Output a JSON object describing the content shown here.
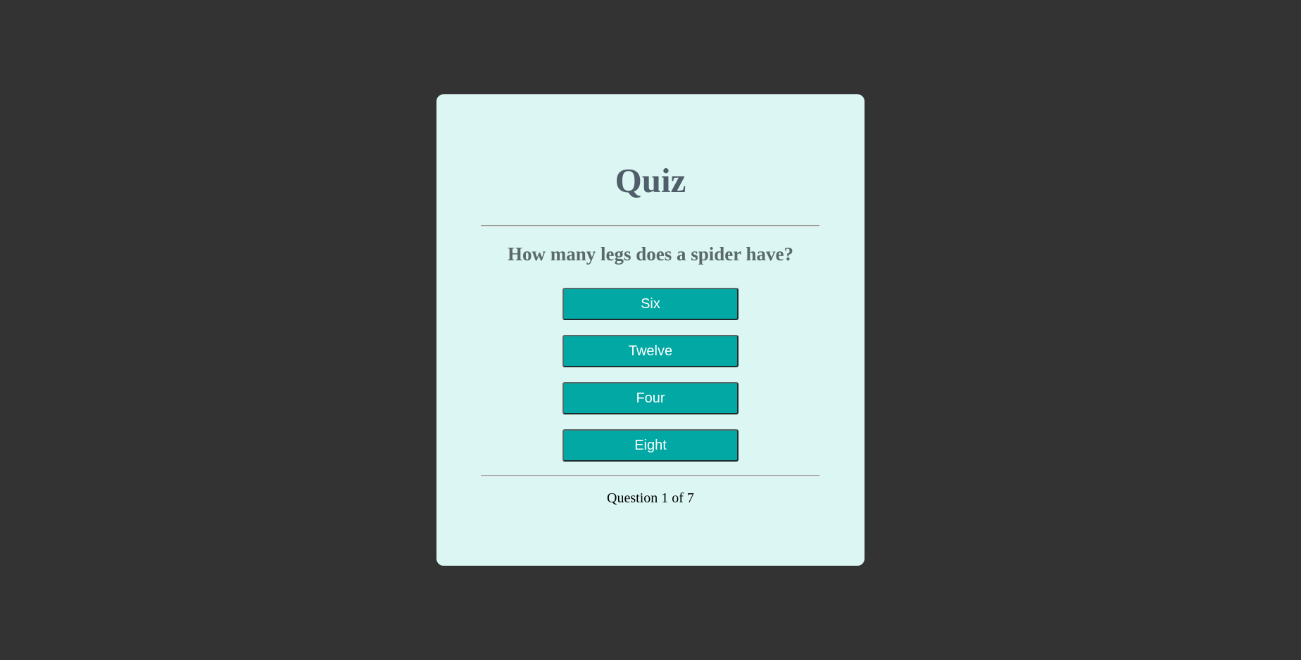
{
  "quiz": {
    "title": "Quiz",
    "question": "How many legs does a spider have?",
    "answers": [
      {
        "label": "Six"
      },
      {
        "label": "Twelve"
      },
      {
        "label": "Four"
      },
      {
        "label": "Eight"
      }
    ],
    "progress": "Question 1 of 7"
  },
  "colors": {
    "page_background": "#333333",
    "card_background": "#dcf7f3",
    "button_background": "#02a8a3",
    "button_text": "#ffffff",
    "title_text": "#4f5e69",
    "question_text": "#5a6a6a"
  }
}
